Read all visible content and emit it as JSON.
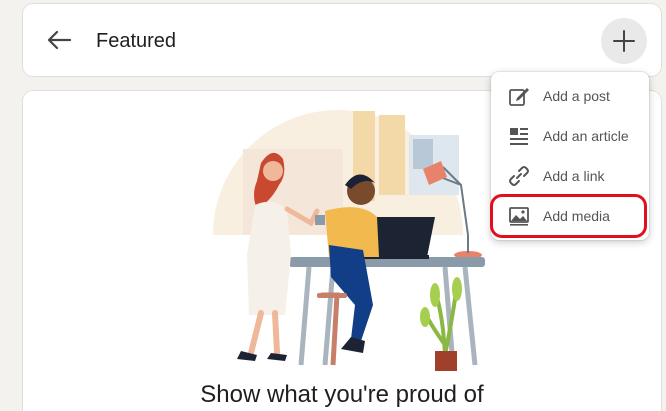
{
  "header": {
    "title": "Featured",
    "back_icon": "arrow-left-icon",
    "add_icon": "plus-icon"
  },
  "menu": {
    "items": [
      {
        "label": "Add a post",
        "icon": "pencil-square-icon"
      },
      {
        "label": "Add an article",
        "icon": "article-icon"
      },
      {
        "label": "Add a link",
        "icon": "link-icon"
      },
      {
        "label": "Add media",
        "icon": "image-icon",
        "highlighted": true
      }
    ]
  },
  "main": {
    "subtitle": "Show what you're proud of"
  },
  "colors": {
    "background": "#f4f2ee",
    "card": "#ffffff",
    "menu_text": "#555555",
    "highlight": "#e0101f"
  }
}
